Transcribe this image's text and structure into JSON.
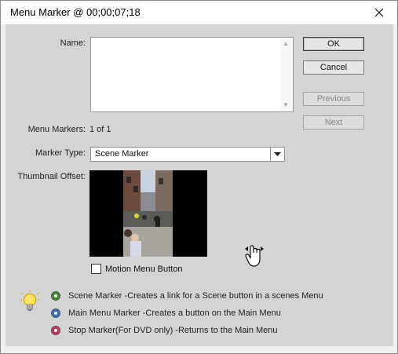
{
  "window": {
    "title": "Menu Marker @ 00;00;07;18"
  },
  "form": {
    "name_label": "Name:",
    "name_value": "",
    "menu_markers_label": "Menu Markers:",
    "menu_markers_value": "1 of 1",
    "marker_type_label": "Marker Type:",
    "marker_type_value": "Scene Marker",
    "thumbnail_offset_label": "Thumbnail Offset:",
    "motion_menu_label": "Motion Menu Button",
    "motion_menu_checked": false
  },
  "buttons": {
    "ok": "OK",
    "cancel": "Cancel",
    "previous": "Previous",
    "next": "Next"
  },
  "legend": [
    {
      "text": "Scene Marker -Creates a link for a Scene button in a scenes Menu",
      "color": "#3a8a2a",
      "icon": "green-dot-icon"
    },
    {
      "text": "Main Menu Marker -Creates a button on the Main Menu",
      "color": "#2f6fd1",
      "icon": "blue-dot-icon"
    },
    {
      "text": "Stop Marker(For DVD only)  -Returns to the Main Menu",
      "color": "#c8355a",
      "icon": "pink-dot-icon"
    }
  ]
}
